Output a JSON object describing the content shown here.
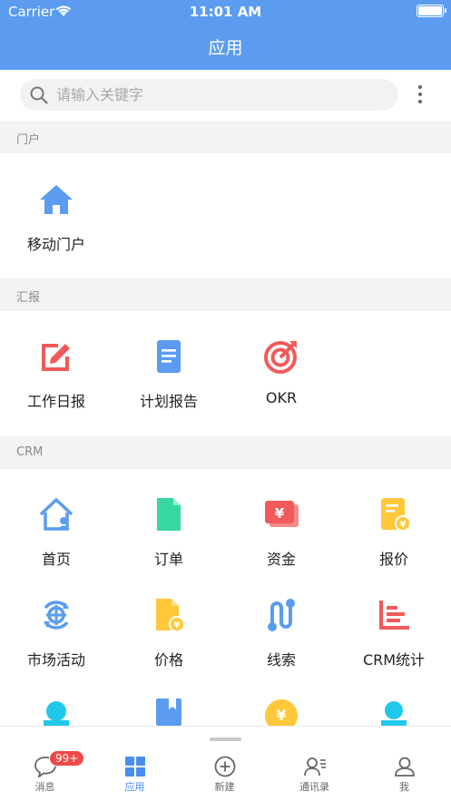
{
  "status": {
    "carrier": "Carrier",
    "time": "11:01 AM"
  },
  "header": {
    "title": "应用"
  },
  "search": {
    "placeholder": "请输入关键字"
  },
  "sections": [
    {
      "title": "门户",
      "items": [
        {
          "label": "移动门户",
          "icon": "home-icon"
        }
      ]
    },
    {
      "title": "汇报",
      "items": [
        {
          "label": "工作日报",
          "icon": "edit-note-icon"
        },
        {
          "label": "计划报告",
          "icon": "document-icon"
        },
        {
          "label": "OKR",
          "icon": "target-icon"
        }
      ]
    },
    {
      "title": "CRM",
      "items": [
        {
          "label": "首页",
          "icon": "house-user-icon"
        },
        {
          "label": "订单",
          "icon": "order-file-icon"
        },
        {
          "label": "资金",
          "icon": "funds-icon"
        },
        {
          "label": "报价",
          "icon": "quote-icon"
        },
        {
          "label": "市场活动",
          "icon": "campaign-icon"
        },
        {
          "label": "价格",
          "icon": "price-file-icon"
        },
        {
          "label": "线索",
          "icon": "lead-path-icon"
        },
        {
          "label": "CRM统计",
          "icon": "stats-icon"
        }
      ]
    }
  ],
  "tabs": [
    {
      "label": "消息",
      "icon": "message-icon",
      "badge": "99+"
    },
    {
      "label": "应用",
      "icon": "apps-grid-icon",
      "active": true
    },
    {
      "label": "新建",
      "icon": "plus-circle-icon"
    },
    {
      "label": "通讯录",
      "icon": "contacts-icon"
    },
    {
      "label": "我",
      "icon": "person-icon"
    }
  ],
  "colors": {
    "header": "#5b9cf0",
    "blue": "#5b9cf0",
    "red": "#f05a5a",
    "green": "#36d8a0",
    "yellow": "#ffc83a",
    "cyan": "#22c8ea"
  }
}
